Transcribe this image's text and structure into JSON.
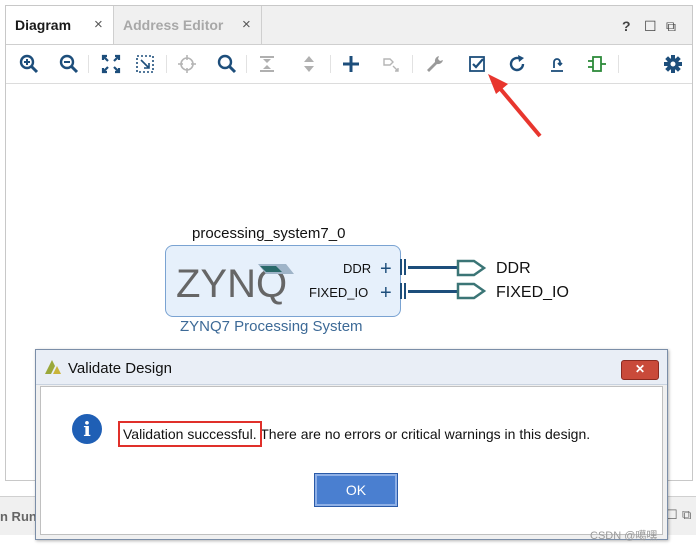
{
  "tabs": [
    {
      "label": "Diagram",
      "close": "×"
    },
    {
      "label": "Address Editor",
      "close": "×"
    }
  ],
  "window_controls": {
    "help": "?",
    "restore": "☐",
    "float": "⧉"
  },
  "toolbar": [
    {
      "icon": "zoom-in-icon"
    },
    {
      "icon": "zoom-out-icon"
    },
    {
      "icon": "zoom-fit-icon"
    },
    {
      "icon": "fit-selection-icon"
    },
    {
      "icon": "crosshair-icon"
    },
    {
      "icon": "search-icon"
    },
    {
      "icon": "collapse-icon"
    },
    {
      "icon": "expand-icon"
    },
    {
      "icon": "add-ip-icon"
    },
    {
      "icon": "make-external-icon"
    },
    {
      "icon": "wrench-icon"
    },
    {
      "icon": "validate-design-icon"
    },
    {
      "icon": "refresh-icon"
    },
    {
      "icon": "regenerate-layout-icon"
    },
    {
      "icon": "port-icon"
    },
    {
      "icon": "settings-gear-icon"
    }
  ],
  "diagram": {
    "block_instance_name": "processing_system7_0",
    "logo_text": "ZYNQ",
    "ports": [
      "DDR",
      "FIXED_IO"
    ],
    "port_plus": "+",
    "block_caption": "ZYNQ7 Processing System",
    "external_ports": [
      "DDR",
      "FIXED_IO"
    ]
  },
  "bottom_panel": {
    "label": "n Run",
    "ctl_min": "☐",
    "ctl_max": "⧉"
  },
  "dialog": {
    "title": "Validate Design",
    "close_glyph": "✕",
    "info_glyph": "i",
    "message_highlight": "Validation successful.",
    "message_rest": " There are no errors or critical warnings in this design.",
    "ok_label": "OK"
  },
  "watermark": "CSDN @噶嘿",
  "colors": {
    "accent": "#1d4e7b",
    "ip_fill": "#e6f0fb",
    "highlight": "#e0302a",
    "annotation_arrow": "#e8362e"
  }
}
